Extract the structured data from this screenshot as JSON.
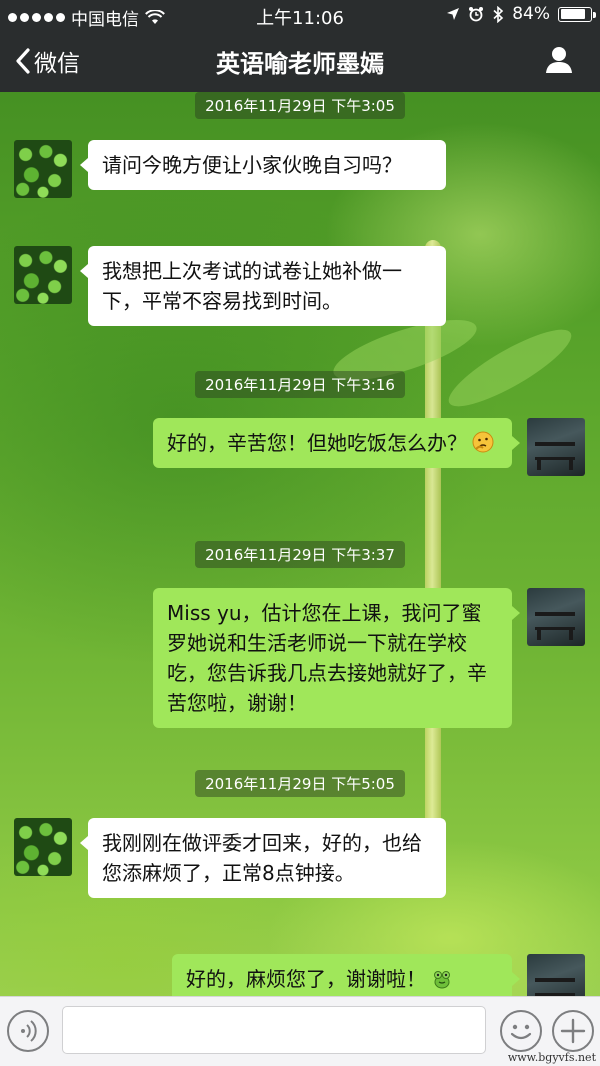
{
  "status_bar": {
    "carrier": "中国电信",
    "time": "上午11:06",
    "battery": "84%",
    "battery_level": 0.84
  },
  "nav": {
    "back_label": "微信",
    "title": "英语喻老师墨嫣"
  },
  "messages": [
    {
      "timestamp": "2016年11月29日 下午3:05"
    },
    {
      "from": "them",
      "text": "请问今晚方便让小家伙晚自习吗？"
    },
    {
      "from": "them",
      "text": "我想把上次考试的试卷让她补做一下，平常不容易找到时间。"
    },
    {
      "timestamp": "2016年11月29日 下午3:16"
    },
    {
      "from": "me",
      "text": "好的，辛苦您！但她吃饭怎么办？",
      "emoji": "thinking-face"
    },
    {
      "timestamp": "2016年11月29日 下午3:37"
    },
    {
      "from": "me",
      "text": "Miss yu，估计您在上课，我问了蜜罗她说和生活老师说一下就在学校吃，您告诉我几点去接她就好了，辛苦您啦，谢谢！"
    },
    {
      "timestamp": "2016年11月29日 下午5:05"
    },
    {
      "from": "them",
      "text": "我刚刚在做评委才回来，好的，也给您添麻烦了，正常8点钟接。"
    },
    {
      "from": "me",
      "text": "好的，麻烦您了，谢谢啦！",
      "emoji": "frog"
    }
  ],
  "watermark": "www.bgyvfs.net"
}
